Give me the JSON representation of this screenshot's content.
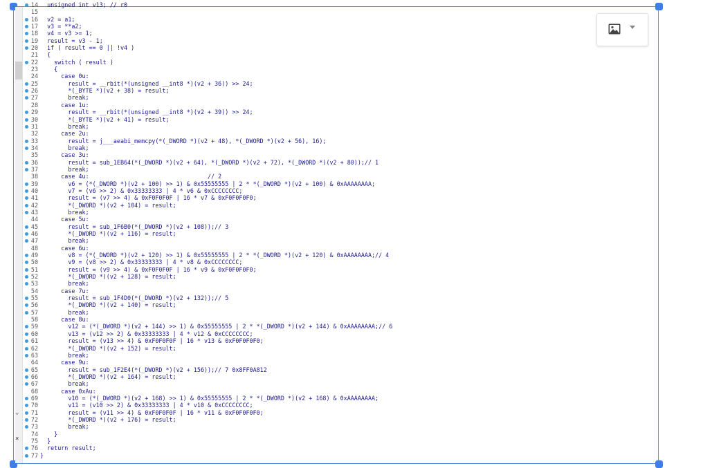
{
  "gutter": {
    "collapse_glyph": "⌄",
    "close_glyph": "×"
  },
  "image_tool": {
    "icon": "image-icon",
    "dropdown_icon": "caret-down-icon"
  },
  "colors": {
    "frame_border": "#5b8fe6",
    "handle": "#3d7ee8",
    "breakpoint_dot": "#3c9be0",
    "code_text": "#1a1a8c"
  },
  "code_lines": [
    {
      "num": "14",
      "dot": true,
      "text": "  unsigned int v13; // r0"
    },
    {
      "num": "15",
      "dot": false,
      "text": ""
    },
    {
      "num": "16",
      "dot": true,
      "text": "  v2 = a1;"
    },
    {
      "num": "17",
      "dot": true,
      "text": "  v3 = **a2;"
    },
    {
      "num": "18",
      "dot": true,
      "text": "  v4 = v3 >= 1;"
    },
    {
      "num": "19",
      "dot": true,
      "text": "  result = v3 - 1;"
    },
    {
      "num": "20",
      "dot": true,
      "text": "  if ( result == 0 || !v4 )"
    },
    {
      "num": "21",
      "dot": false,
      "text": "  {"
    },
    {
      "num": "22",
      "dot": true,
      "text": "    switch ( result )"
    },
    {
      "num": "23",
      "dot": false,
      "text": "    {"
    },
    {
      "num": "24",
      "dot": false,
      "text": "      case 0u:"
    },
    {
      "num": "25",
      "dot": true,
      "text": "        result = __rbit(*(unsigned __int8 *)(v2 + 36)) >> 24;"
    },
    {
      "num": "26",
      "dot": true,
      "text": "        *(_BYTE *)(v2 + 38) = result;"
    },
    {
      "num": "27",
      "dot": true,
      "text": "        break;"
    },
    {
      "num": "28",
      "dot": false,
      "text": "      case 1u:"
    },
    {
      "num": "29",
      "dot": true,
      "text": "        result = __rbit(*(unsigned __int8 *)(v2 + 39)) >> 24;"
    },
    {
      "num": "30",
      "dot": true,
      "text": "        *(_BYTE *)(v2 + 41) = result;"
    },
    {
      "num": "31",
      "dot": true,
      "text": "        break;"
    },
    {
      "num": "32",
      "dot": false,
      "text": "      case 2u:"
    },
    {
      "num": "33",
      "dot": true,
      "text": "        result = j___aeabi_memcpy(*(_DWORD *)(v2 + 48), *(_DWORD *)(v2 + 56), 16);"
    },
    {
      "num": "34",
      "dot": true,
      "text": "        break;"
    },
    {
      "num": "35",
      "dot": false,
      "text": "      case 3u:"
    },
    {
      "num": "36",
      "dot": true,
      "text": "        result = sub_1EB64(*(_DWORD *)(v2 + 64), *(_DWORD *)(v2 + 72), *(_DWORD *)(v2 + 80));// 1"
    },
    {
      "num": "37",
      "dot": true,
      "text": "        break;"
    },
    {
      "num": "38",
      "dot": false,
      "text": "      case 4u:                                  // 2"
    },
    {
      "num": "39",
      "dot": true,
      "text": "        v6 = (*(_DWORD *)(v2 + 100) >> 1) & 0x55555555 | 2 * *(_DWORD *)(v2 + 100) & 0xAAAAAAAA;"
    },
    {
      "num": "40",
      "dot": true,
      "text": "        v7 = (v6 >> 2) & 0x33333333 | 4 * v6 & 0xCCCCCCCC;"
    },
    {
      "num": "41",
      "dot": true,
      "text": "        result = (v7 >> 4) & 0xF0F0F0F | 16 * v7 & 0xF0F0F0F0;"
    },
    {
      "num": "42",
      "dot": true,
      "text": "        *(_DWORD *)(v2 + 104) = result;"
    },
    {
      "num": "43",
      "dot": true,
      "text": "        break;"
    },
    {
      "num": "44",
      "dot": false,
      "text": "      case 5u:"
    },
    {
      "num": "45",
      "dot": true,
      "text": "        result = sub_1F6B0(*(_DWORD *)(v2 + 108));// 3"
    },
    {
      "num": "46",
      "dot": true,
      "text": "        *(_DWORD *)(v2 + 116) = result;"
    },
    {
      "num": "47",
      "dot": true,
      "text": "        break;"
    },
    {
      "num": "48",
      "dot": false,
      "text": "      case 6u:"
    },
    {
      "num": "49",
      "dot": true,
      "text": "        v8 = (*(_DWORD *)(v2 + 120) >> 1) & 0x55555555 | 2 * *(_DWORD *)(v2 + 120) & 0xAAAAAAAA;// 4"
    },
    {
      "num": "50",
      "dot": true,
      "text": "        v9 = (v8 >> 2) & 0x33333333 | 4 * v8 & 0xCCCCCCCC;"
    },
    {
      "num": "51",
      "dot": true,
      "text": "        result = (v9 >> 4) & 0xF0F0F0F | 16 * v9 & 0xF0F0F0F0;"
    },
    {
      "num": "52",
      "dot": true,
      "text": "        *(_DWORD *)(v2 + 128) = result;"
    },
    {
      "num": "53",
      "dot": true,
      "text": "        break;"
    },
    {
      "num": "54",
      "dot": false,
      "text": "      case 7u:"
    },
    {
      "num": "55",
      "dot": true,
      "text": "        result = sub_1F4D0(*(_DWORD *)(v2 + 132));// 5"
    },
    {
      "num": "56",
      "dot": true,
      "text": "        *(_DWORD *)(v2 + 140) = result;"
    },
    {
      "num": "57",
      "dot": true,
      "text": "        break;"
    },
    {
      "num": "58",
      "dot": false,
      "text": "      case 8u:"
    },
    {
      "num": "59",
      "dot": true,
      "text": "        v12 = (*(_DWORD *)(v2 + 144) >> 1) & 0x55555555 | 2 * *(_DWORD *)(v2 + 144) & 0xAAAAAAAA;// 6"
    },
    {
      "num": "60",
      "dot": true,
      "text": "        v13 = (v12 >> 2) & 0x33333333 | 4 * v12 & 0xCCCCCCCC;"
    },
    {
      "num": "61",
      "dot": true,
      "text": "        result = (v13 >> 4) & 0xF0F0F0F | 16 * v13 & 0xF0F0F0F0;"
    },
    {
      "num": "62",
      "dot": true,
      "text": "        *(_DWORD *)(v2 + 152) = result;"
    },
    {
      "num": "63",
      "dot": true,
      "text": "        break;"
    },
    {
      "num": "64",
      "dot": false,
      "text": "      case 9u:"
    },
    {
      "num": "65",
      "dot": true,
      "text": "        result = sub_1F2E4(*(_DWORD *)(v2 + 156));// 7 0x8FF0A812"
    },
    {
      "num": "66",
      "dot": true,
      "text": "        *(_DWORD *)(v2 + 164) = result;"
    },
    {
      "num": "67",
      "dot": true,
      "text": "        break;"
    },
    {
      "num": "68",
      "dot": false,
      "text": "      case 0xAu:"
    },
    {
      "num": "69",
      "dot": true,
      "text": "        v10 = (*(_DWORD *)(v2 + 168) >> 1) & 0x55555555 | 2 * *(_DWORD *)(v2 + 168) & 0xAAAAAAAA;"
    },
    {
      "num": "70",
      "dot": true,
      "text": "        v11 = (v10 >> 2) & 0x33333333 | 4 * v10 & 0xCCCCCCCC;"
    },
    {
      "num": "71",
      "dot": true,
      "text": "        result = (v11 >> 4) & 0xF0F0F0F | 16 * v11 & 0xF0F0F0F0;"
    },
    {
      "num": "72",
      "dot": true,
      "text": "        *(_DWORD *)(v2 + 176) = result;"
    },
    {
      "num": "73",
      "dot": true,
      "text": "        break;"
    },
    {
      "num": "74",
      "dot": false,
      "text": "    }"
    },
    {
      "num": "75",
      "dot": false,
      "text": "  }"
    },
    {
      "num": "76",
      "dot": true,
      "text": "  return result;"
    },
    {
      "num": "77",
      "dot": true,
      "text": "}"
    }
  ]
}
